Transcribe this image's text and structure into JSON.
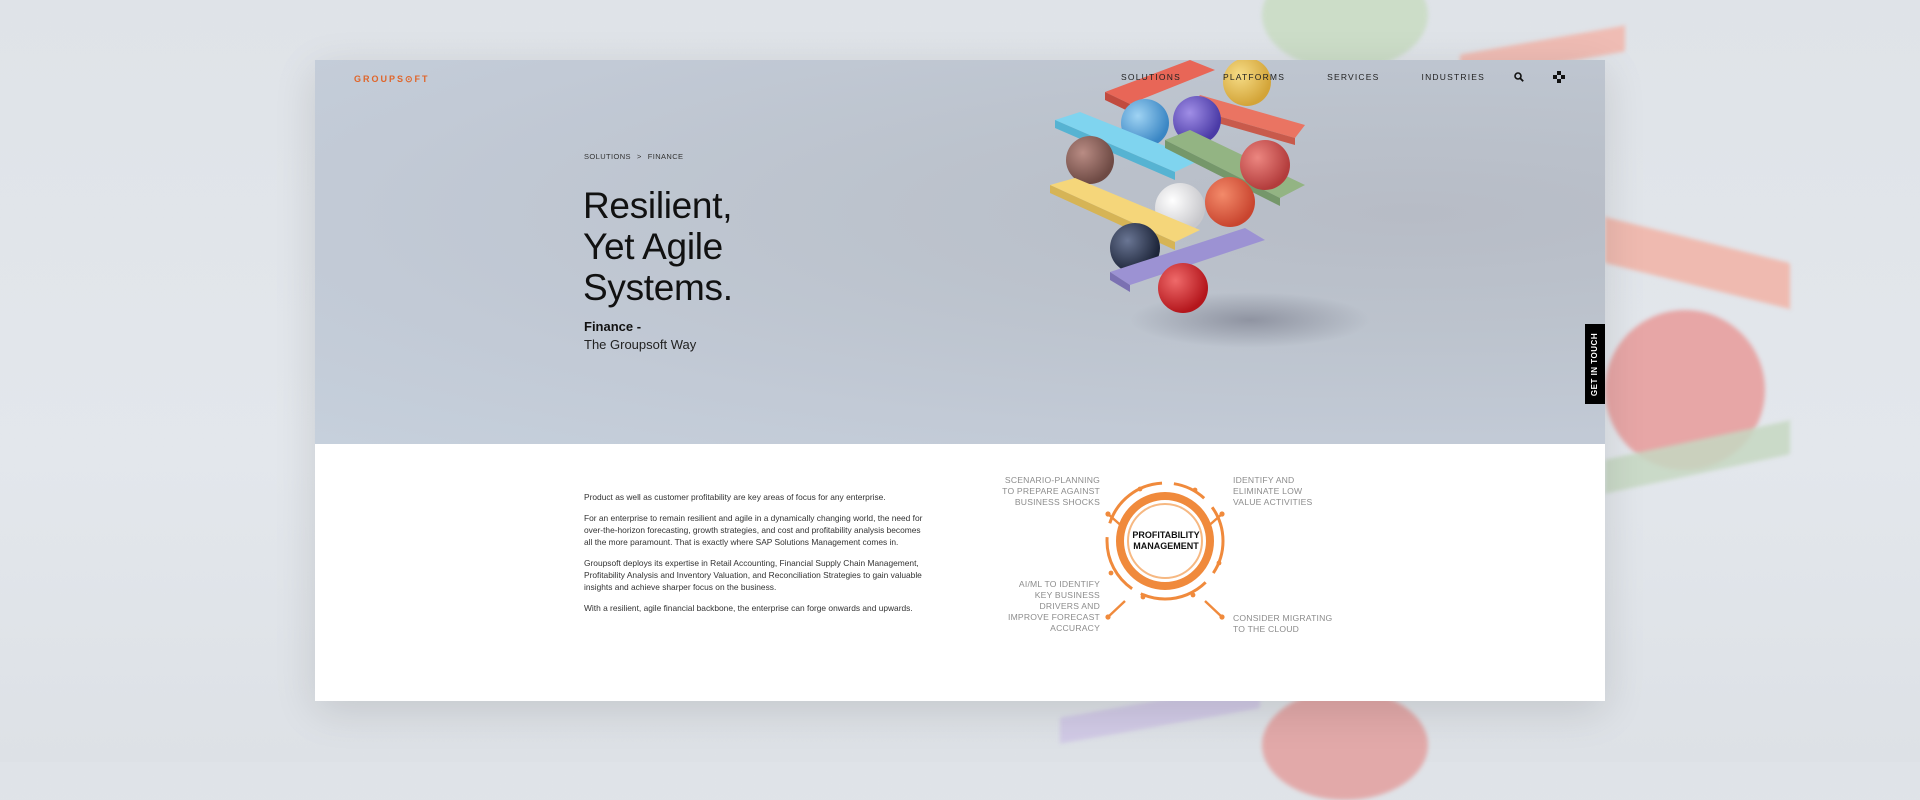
{
  "brand": {
    "logo_text": "GROUPS⊙FT",
    "accent_color": "#e0652a"
  },
  "nav": {
    "items": [
      "SOLUTIONS",
      "PLATFORMS",
      "SERVICES",
      "INDUSTRIES"
    ],
    "search_icon": "search-icon",
    "menu_icon": "grid-menu-icon"
  },
  "breadcrumb": {
    "items": [
      "SOLUTIONS",
      "FINANCE"
    ],
    "separator": ">"
  },
  "hero": {
    "title_lines": [
      "Resilient,",
      "Yet Agile",
      "Systems."
    ],
    "subtitle_bold": "Finance -",
    "subtitle": "The Groupsoft Way"
  },
  "cta": {
    "get_in_touch": "GET IN TOUCH"
  },
  "body": {
    "paragraphs": [
      "Product as well as customer profitability are key areas of focus for any enterprise.",
      "For an enterprise to remain resilient and agile in a dynamically changing world, the need for over-the-horizon forecasting, growth strategies, and cost and profitability analysis becomes all the more paramount. That is exactly where SAP Solutions Management comes in.",
      "Groupsoft deploys its expertise in Retail Accounting, Financial Supply Chain Management, Profitability Analysis and Inventory Valuation, and Reconciliation Strategies to gain valuable insights and achieve sharper focus on the business.",
      "With a resilient, agile financial backbone, the enterprise can forge onwards and upwards."
    ]
  },
  "diagram": {
    "center": [
      "PROFITABILITY",
      "MANAGEMENT"
    ],
    "top_left": [
      "SCENARIO-PLANNING",
      "TO PREPARE AGAINST",
      "BUSINESS SHOCKS"
    ],
    "top_right": [
      "IDENTIFY AND",
      "ELIMINATE LOW",
      "VALUE ACTIVITIES"
    ],
    "bottom_left": [
      "AI/ML TO IDENTIFY",
      "KEY BUSINESS",
      "DRIVERS AND",
      "IMPROVE FORECAST",
      "ACCURACY"
    ],
    "bottom_right": [
      "CONSIDER MIGRATING",
      "TO THE CLOUD"
    ],
    "ring_color": "#f08a3c"
  }
}
